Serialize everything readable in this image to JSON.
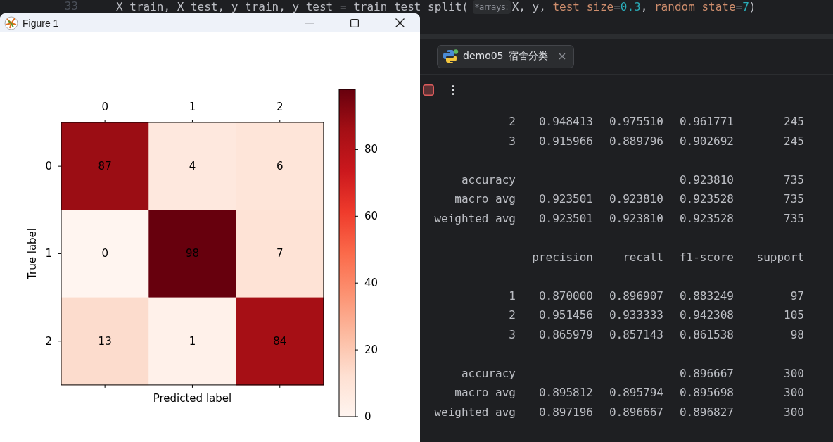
{
  "editor": {
    "line_number": "33",
    "code_before_hint": [
      {
        "kind": "plain",
        "text": "X_train, X_test, y_train, y_test = train_test_split("
      }
    ],
    "hint": "*arrays:",
    "code_after_hint": [
      {
        "kind": "plain",
        "text": "X, y, "
      },
      {
        "kind": "param",
        "text": "test_size"
      },
      {
        "kind": "plain",
        "text": "="
      },
      {
        "kind": "number",
        "text": "0.3"
      },
      {
        "kind": "plain",
        "text": ", "
      },
      {
        "kind": "param",
        "text": "random_state"
      },
      {
        "kind": "plain",
        "text": "="
      },
      {
        "kind": "number",
        "text": "7"
      },
      {
        "kind": "plain",
        "text": ")"
      }
    ]
  },
  "run_tab": {
    "label": "demo05_宿舍分类"
  },
  "output": {
    "lines": [
      {
        "kind": "row",
        "label": "2",
        "precision": "0.948413",
        "recall": "0.975510",
        "f1": "0.961771",
        "support": "245"
      },
      {
        "kind": "row",
        "label": "3",
        "precision": "0.915966",
        "recall": "0.889796",
        "f1": "0.902692",
        "support": "245"
      },
      {
        "kind": "blank"
      },
      {
        "kind": "row",
        "label": "accuracy",
        "f1": "0.923810",
        "support": "735"
      },
      {
        "kind": "row",
        "label": "macro avg",
        "precision": "0.923501",
        "recall": "0.923810",
        "f1": "0.923528",
        "support": "735"
      },
      {
        "kind": "row",
        "label": "weighted avg",
        "precision": "0.923501",
        "recall": "0.923810",
        "f1": "0.923528",
        "support": "735"
      },
      {
        "kind": "blank"
      },
      {
        "kind": "row",
        "precision": "precision",
        "recall": "recall",
        "f1": "f1-score",
        "support": "support"
      },
      {
        "kind": "blank"
      },
      {
        "kind": "row",
        "label": "1",
        "precision": "0.870000",
        "recall": "0.896907",
        "f1": "0.883249",
        "support": "97"
      },
      {
        "kind": "row",
        "label": "2",
        "precision": "0.951456",
        "recall": "0.933333",
        "f1": "0.942308",
        "support": "105"
      },
      {
        "kind": "row",
        "label": "3",
        "precision": "0.865979",
        "recall": "0.857143",
        "f1": "0.861538",
        "support": "98"
      },
      {
        "kind": "blank"
      },
      {
        "kind": "row",
        "label": "accuracy",
        "f1": "0.896667",
        "support": "300"
      },
      {
        "kind": "row",
        "label": "macro avg",
        "precision": "0.895812",
        "recall": "0.895794",
        "f1": "0.895698",
        "support": "300"
      },
      {
        "kind": "row",
        "label": "weighted avg",
        "precision": "0.897196",
        "recall": "0.896667",
        "f1": "0.896827",
        "support": "300"
      }
    ]
  },
  "figure": {
    "window": {
      "title": "Figure 1"
    },
    "column_ticks": [
      "0",
      "1",
      "2"
    ],
    "row_ticks": [
      "0",
      "1",
      "2"
    ],
    "xlabel": "Predicted label",
    "ylabel": "True label",
    "matrix": {
      "rows": [
        {
          "cells": [
            {
              "value": "87",
              "color": "#9b0d14"
            },
            {
              "value": "4",
              "color": "#fee8de"
            },
            {
              "value": "6",
              "color": "#fee5d9"
            }
          ]
        },
        {
          "cells": [
            {
              "value": "0",
              "color": "#fff5f0"
            },
            {
              "value": "98",
              "color": "#67000d"
            },
            {
              "value": "7",
              "color": "#fee3d6"
            }
          ]
        },
        {
          "cells": [
            {
              "value": "13",
              "color": "#fcdccd"
            },
            {
              "value": "1",
              "color": "#fff1ea"
            },
            {
              "value": "84",
              "color": "#a60f15"
            }
          ]
        }
      ]
    },
    "colorbar_ticks": [
      "80",
      "60",
      "40",
      "20",
      "0"
    ]
  }
}
